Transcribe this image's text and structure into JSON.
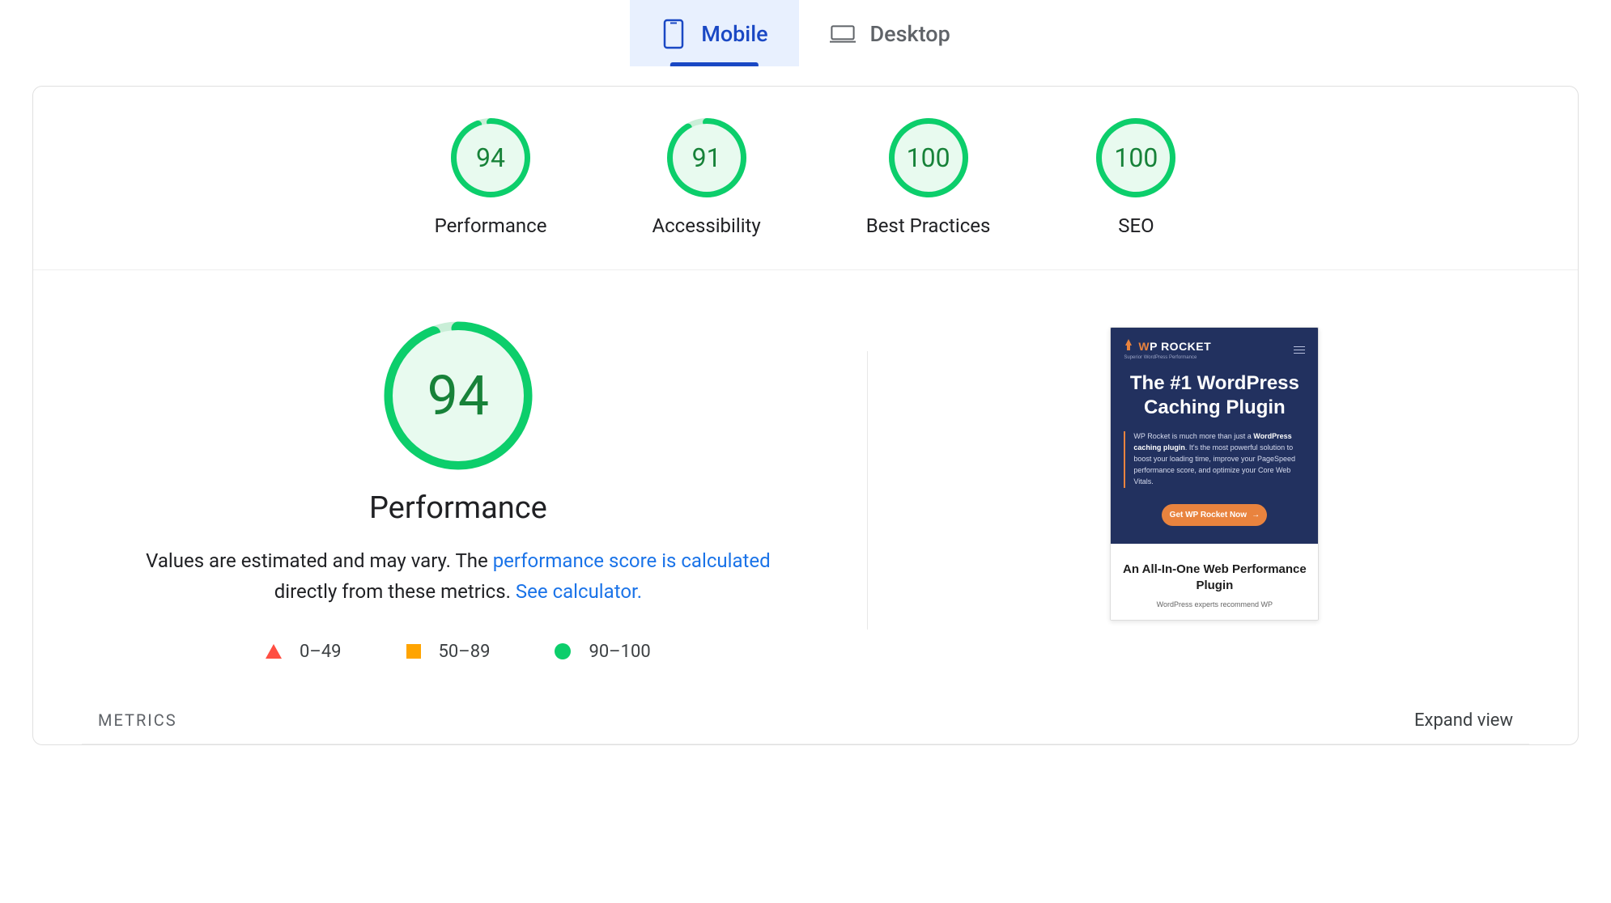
{
  "tabs": {
    "mobile": "Mobile",
    "desktop": "Desktop"
  },
  "gauges": [
    {
      "score": "94",
      "label": "Performance"
    },
    {
      "score": "91",
      "label": "Accessibility"
    },
    {
      "score": "100",
      "label": "Best Practices"
    },
    {
      "score": "100",
      "label": "SEO"
    }
  ],
  "perf": {
    "score": "94",
    "title": "Performance",
    "desc_prefix": "Values are estimated and may vary. The ",
    "desc_link1": "performance score is calculated",
    "desc_mid": " directly from these metrics. ",
    "desc_link2": "See calculator."
  },
  "legend": {
    "r1": "0–49",
    "r2": "50–89",
    "r3": "90–100"
  },
  "shot": {
    "brand_prefix": "W",
    "brand_rest": "P ROCKET",
    "brand_sub": "Superior WordPress Performance",
    "headline": "The #1 WordPress Caching Plugin",
    "body_p1": "WP Rocket is much more than just a ",
    "body_bold": "WordPress caching plugin",
    "body_p2": ". It's the most powerful solution to boost your loading time, improve your PageSpeed performance score, and optimize your Core Web Vitals.",
    "cta": "Get WP Rocket Now",
    "sub_h": "An All-In-One Web Performance Plugin",
    "sub_p": "WordPress experts recommend WP"
  },
  "metrics": {
    "label": "METRICS",
    "expand": "Expand view"
  }
}
